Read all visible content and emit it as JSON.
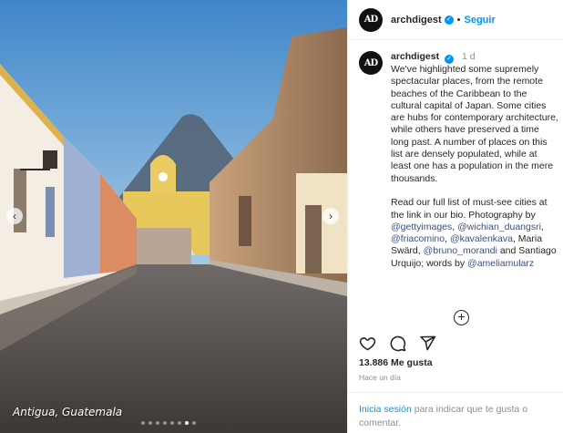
{
  "header": {
    "avatar_text": "AD",
    "username": "archdigest",
    "verified_mark": "✓",
    "separator": "•",
    "follow_label": "Seguir"
  },
  "photo": {
    "caption": "Antigua, Guatemala",
    "prev_icon": "‹",
    "next_icon": "›",
    "slide_count": 8,
    "active_slide": 7
  },
  "comment": {
    "username": "archdigest",
    "time": "1 d",
    "text_intro": "We've highlighted some supremely spectacular places, from the remote beaches of the Caribbean to the cultural capital of Japan. Some cities are hubs for contemporary architecture, while others have preserved a time long past. A number of places on this list are densely populated, while at least one has a population in the mere thousands.\n\nRead our full list of must-see cities at the link in our bio. Photography by ",
    "mentions": [
      "@gettyimages",
      "@wichian_duangsri",
      "@friacomino",
      "@kavalenkava",
      "@bruno_morandi",
      "@ameliamularz"
    ],
    "sep_1": ", ",
    "sep_2": ", ",
    "sep_3": ", ",
    "sep_4": ", Maria Swärd, ",
    "sep_5": " and Santiago Urquijo; words by "
  },
  "more_comments_icon": "+",
  "actions": {
    "like_icon": "heart-icon",
    "comment_icon": "comment-icon",
    "share_icon": "share-icon"
  },
  "likes": "13.886 Me gusta",
  "post_time": "Hace un día",
  "login": {
    "link": "Inicia sesión",
    "rest": " para indicar que te gusta o comentar."
  }
}
